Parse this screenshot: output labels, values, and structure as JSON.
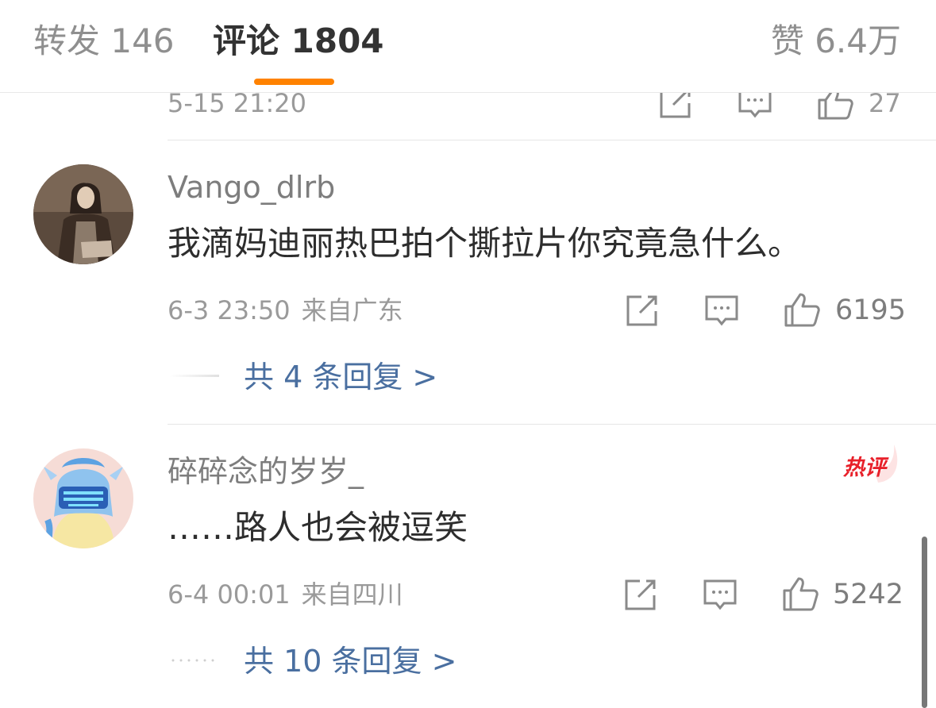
{
  "tabs": {
    "repost": "转发 146",
    "comment": "评论 1804",
    "like": "赞 6.4万"
  },
  "prev_row": {
    "time": "5-15 21:20",
    "like_count": "27"
  },
  "comments": [
    {
      "username": "Vango_dlrb",
      "text": "我滴妈迪丽热巴拍个撕拉片你究竟急什么。",
      "time": "6-3 23:50",
      "location": "来自广东",
      "like_count": "6195",
      "replies": "共 4 条回复 >"
    },
    {
      "username": "碎碎念的岁岁_",
      "badge": "热评",
      "text": "……路人也会被逗笑",
      "time": "6-4 00:01",
      "location": "来自四川",
      "like_count": "5242",
      "replies": "共 10 条回复 >"
    }
  ],
  "icons": {
    "share": "share-icon",
    "comment": "comment-icon",
    "like": "thumbs-up-icon"
  },
  "colors": {
    "accent": "#ff8200",
    "link": "#4a6fa0",
    "hot_badge": "#e8202a"
  }
}
